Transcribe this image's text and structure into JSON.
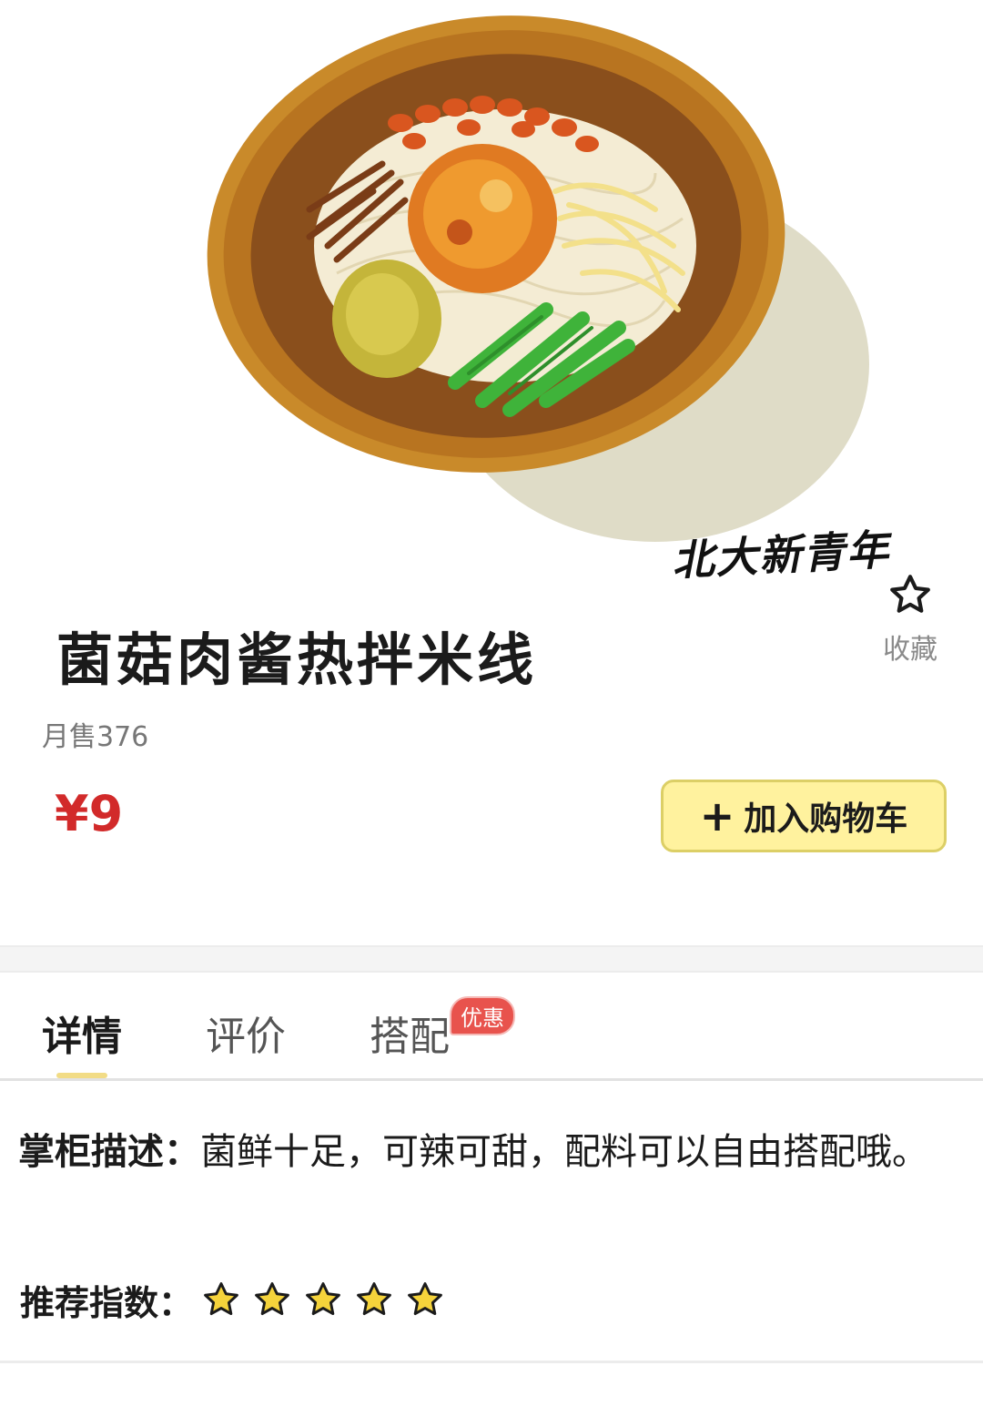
{
  "hero": {
    "image_description": "hand-drawn bowl of noodles with toppings"
  },
  "watermark": {
    "text": "北大新青年"
  },
  "dish": {
    "title": "菌菇肉酱热拌米线",
    "monthly_sales": "月售376",
    "price": "¥9"
  },
  "favorite": {
    "label": "收藏",
    "icon": "star-outline-icon"
  },
  "cart_button": {
    "plus": "+",
    "label": "加入购物车",
    "icon": "plus-icon"
  },
  "tabs": [
    {
      "label": "详情",
      "active": true
    },
    {
      "label": "评价",
      "active": false
    },
    {
      "label": "搭配",
      "active": false,
      "badge": "优惠"
    }
  ],
  "description": {
    "label": "掌柜描述：",
    "text": "菌鲜十足，可辣可甜，配料可以自由搭配哦。"
  },
  "rating": {
    "label": "推荐指数：",
    "stars": 5,
    "max_stars": 5,
    "star_color": "#f5d33b"
  },
  "colors": {
    "price": "#d22a2a",
    "cart_button_bg": "#fff29e",
    "promo_badge": "#e8534d"
  }
}
